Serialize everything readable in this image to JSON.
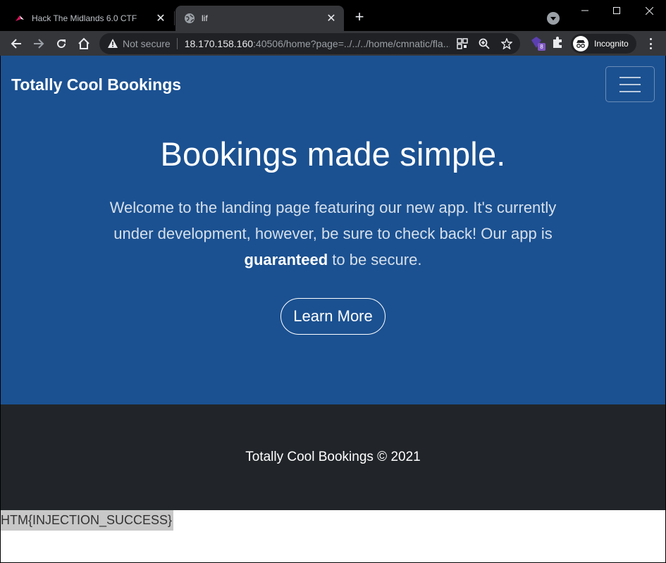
{
  "browser": {
    "tabs": [
      {
        "title": "Hack The Midlands 6.0 CTF",
        "active": false
      },
      {
        "title": "lif",
        "active": true
      }
    ],
    "new_tab_label": "+",
    "address_bar": {
      "security_label": "Not secure",
      "url_host": "18.170.158.160",
      "url_rest": ":40506/home?page=../../../home/cmnatic/fla..."
    },
    "extension_badge": "8",
    "profile_label": "Incognito"
  },
  "site": {
    "brand": "Totally Cool Bookings",
    "hero": {
      "title": "Bookings made simple.",
      "lead_part1": "Welcome to the landing page featuring our new app. It's currently under development, however, be sure to check back! Our app is ",
      "lead_bold": "guaranteed",
      "lead_part2": " to be secure.",
      "cta": "Learn More"
    },
    "footer_text": "Totally Cool Bookings © 2021",
    "injected_output": "HTM{INJECTION_SUCCESS}"
  },
  "colors": {
    "brand_blue": "#1b5191",
    "footer_dark": "#212529",
    "chrome_dark": "#35363a"
  }
}
